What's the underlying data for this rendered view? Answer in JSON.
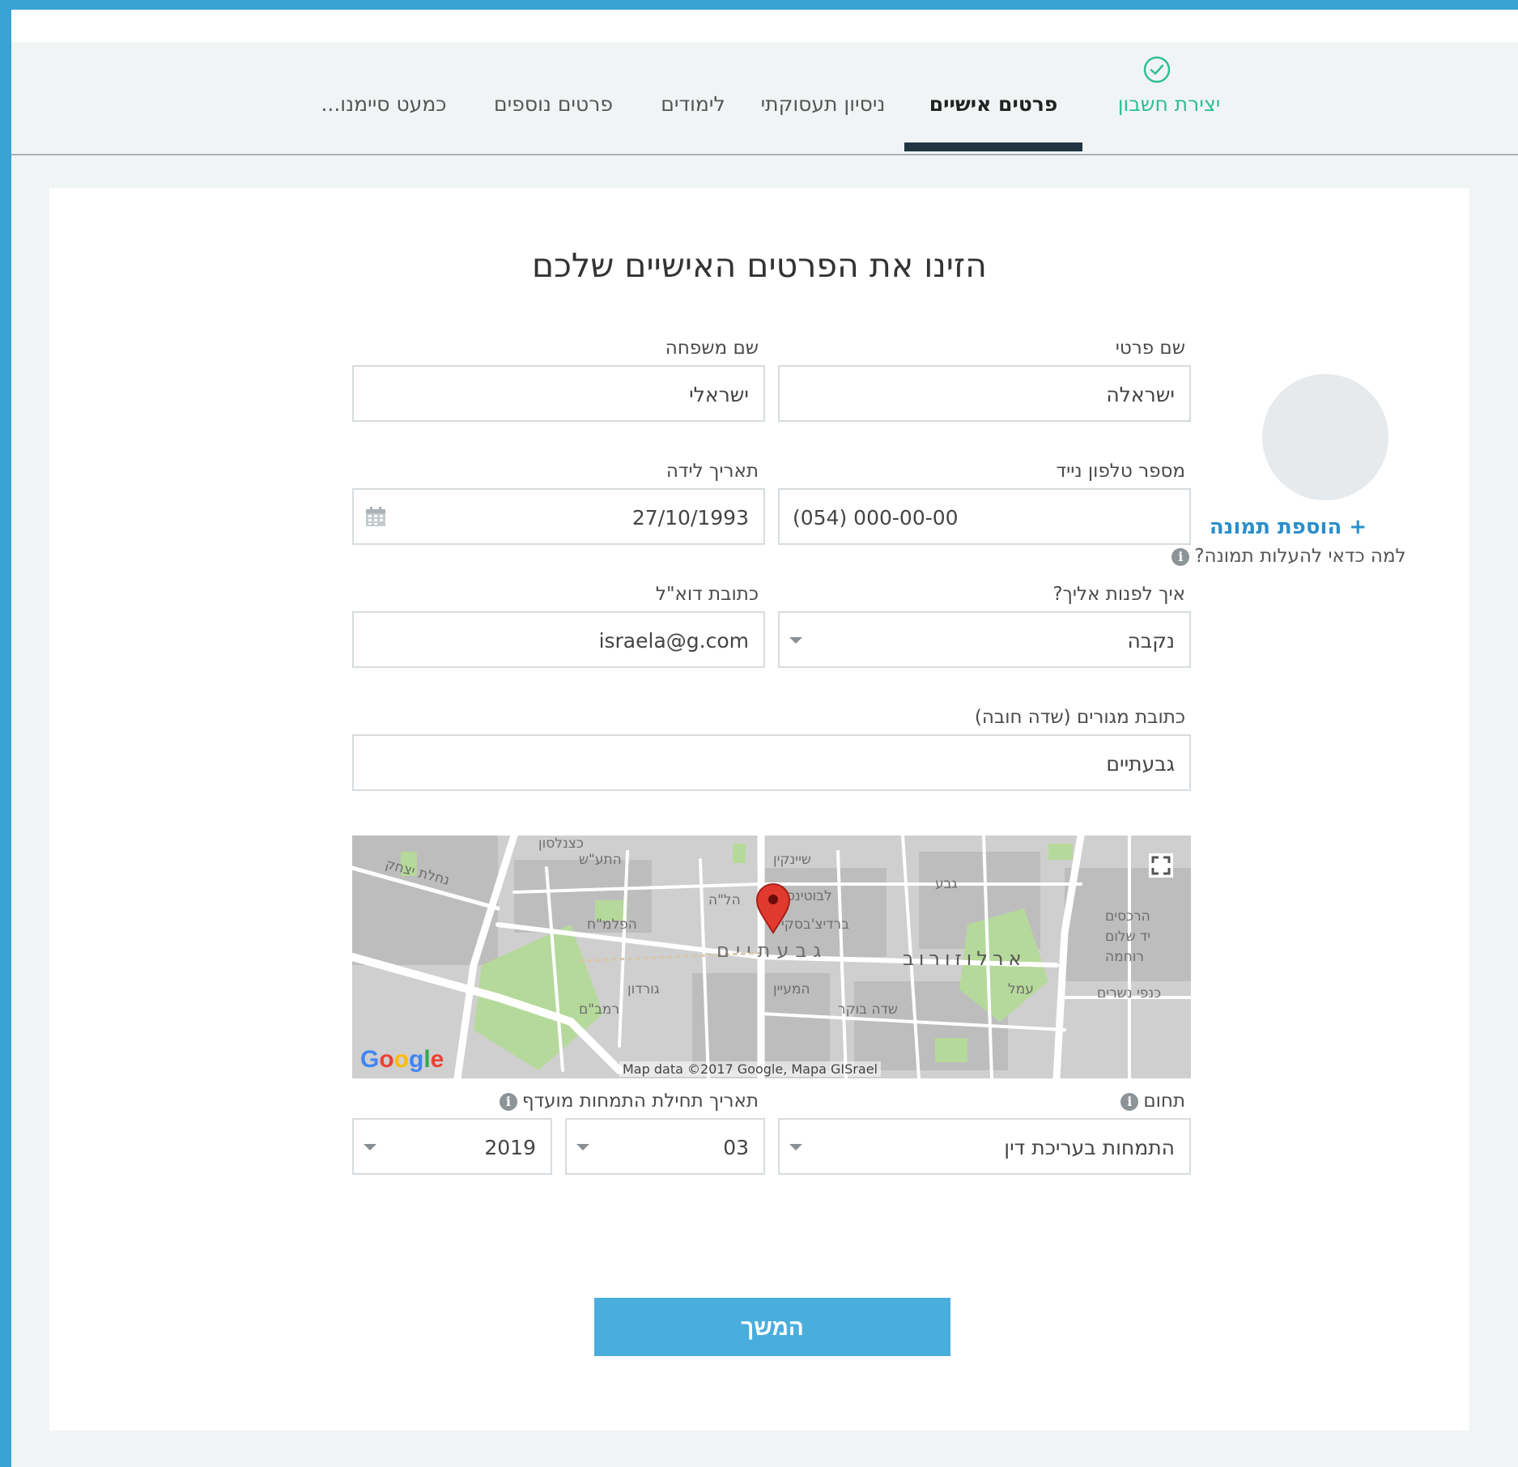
{
  "tabs": [
    {
      "label": "יצירת חשבון",
      "state": "done"
    },
    {
      "label": "פרטים אישיים",
      "state": "active"
    },
    {
      "label": "ניסיון תעסוקתי",
      "state": "pending"
    },
    {
      "label": "לימודים",
      "state": "pending"
    },
    {
      "label": "פרטים נוספים",
      "state": "pending"
    },
    {
      "label": "כמעט סיימנו...",
      "state": "pending"
    }
  ],
  "colors": {
    "done": "#2ebf93",
    "accent": "#4aaedd",
    "link": "#2b8fc9",
    "active_underline": "#223443"
  },
  "form": {
    "heading": "הזינו את הפרטים האישיים שלכם",
    "first_name": {
      "label": "שם פרטי",
      "value": "ישראלה"
    },
    "last_name": {
      "label": "שם משפחה",
      "value": "ישראלי"
    },
    "mobile": {
      "label": "מספר טלפון נייד",
      "value": "(054) 000-00-00"
    },
    "birth_date": {
      "label": "תאריך לידה",
      "value": "27/10/1993"
    },
    "salutation": {
      "label": "איך לפנות אליך?",
      "value": "נקבה"
    },
    "email": {
      "label": "כתובת דוא\"ל",
      "value": "israela@g.com"
    },
    "address": {
      "label": "כתובת מגורים (שדה חובה)",
      "value": "גבעתיים"
    },
    "field": {
      "label": "תחום",
      "value": "התמחות בעריכת דין"
    },
    "internship_date": {
      "label": "תאריך תחילת התמחות מועדף",
      "month": "03",
      "year": "2019"
    }
  },
  "photo": {
    "add_label": "הוספת תמונה",
    "add_icon": "+",
    "why_label": "למה כדאי להעלות תמונה?"
  },
  "info_icon": "i",
  "map": {
    "credit": "Map data ©2017 Google, Mapa GISrael",
    "logo": "Google",
    "labels": [
      "נחלת יצחק",
      "התע\"ש",
      "הל\"ה",
      "לבוטינסקי",
      "ברדיצ'בסקי",
      "הפלמ\"ח",
      "גבעתיים",
      "ארלוזורוב",
      "שיינקין",
      "גבע",
      "הרכסים",
      "יד שלום",
      "רוחמה",
      "שדה בוקר",
      "המעיין",
      "גורדון",
      "רמב\"ם",
      "כצנלסון",
      "עמל",
      "כנפי נשרים"
    ]
  },
  "continue_label": "המשך"
}
